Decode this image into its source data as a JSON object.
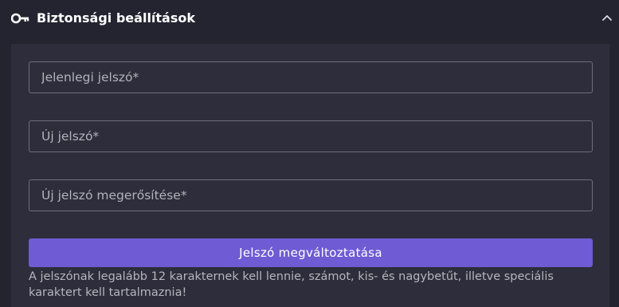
{
  "section": {
    "title": "Biztonsági beállítások",
    "icon": "key-icon",
    "toggle_icon": "chevron-up-icon"
  },
  "form": {
    "current_password": {
      "placeholder": "Jelenlegi jelszó*",
      "value": ""
    },
    "new_password": {
      "placeholder": "Új jelszó*",
      "value": ""
    },
    "confirm_password": {
      "placeholder": "Új jelszó megerősítése*",
      "value": ""
    },
    "submit_label": "Jelszó megváltoztatása",
    "hint": "A jelszónak legalább 12 karakternek kell lennie, számot, kis- és nagybetűt, illetve speciális karaktert kell tartalmaznia!"
  },
  "colors": {
    "page_background": "#242431",
    "panel_background": "#2d2d3b",
    "accent": "#6f5bd3",
    "field_border": "#6e6e7c",
    "text_primary": "#ffffff",
    "text_muted": "#b6b6c0"
  }
}
